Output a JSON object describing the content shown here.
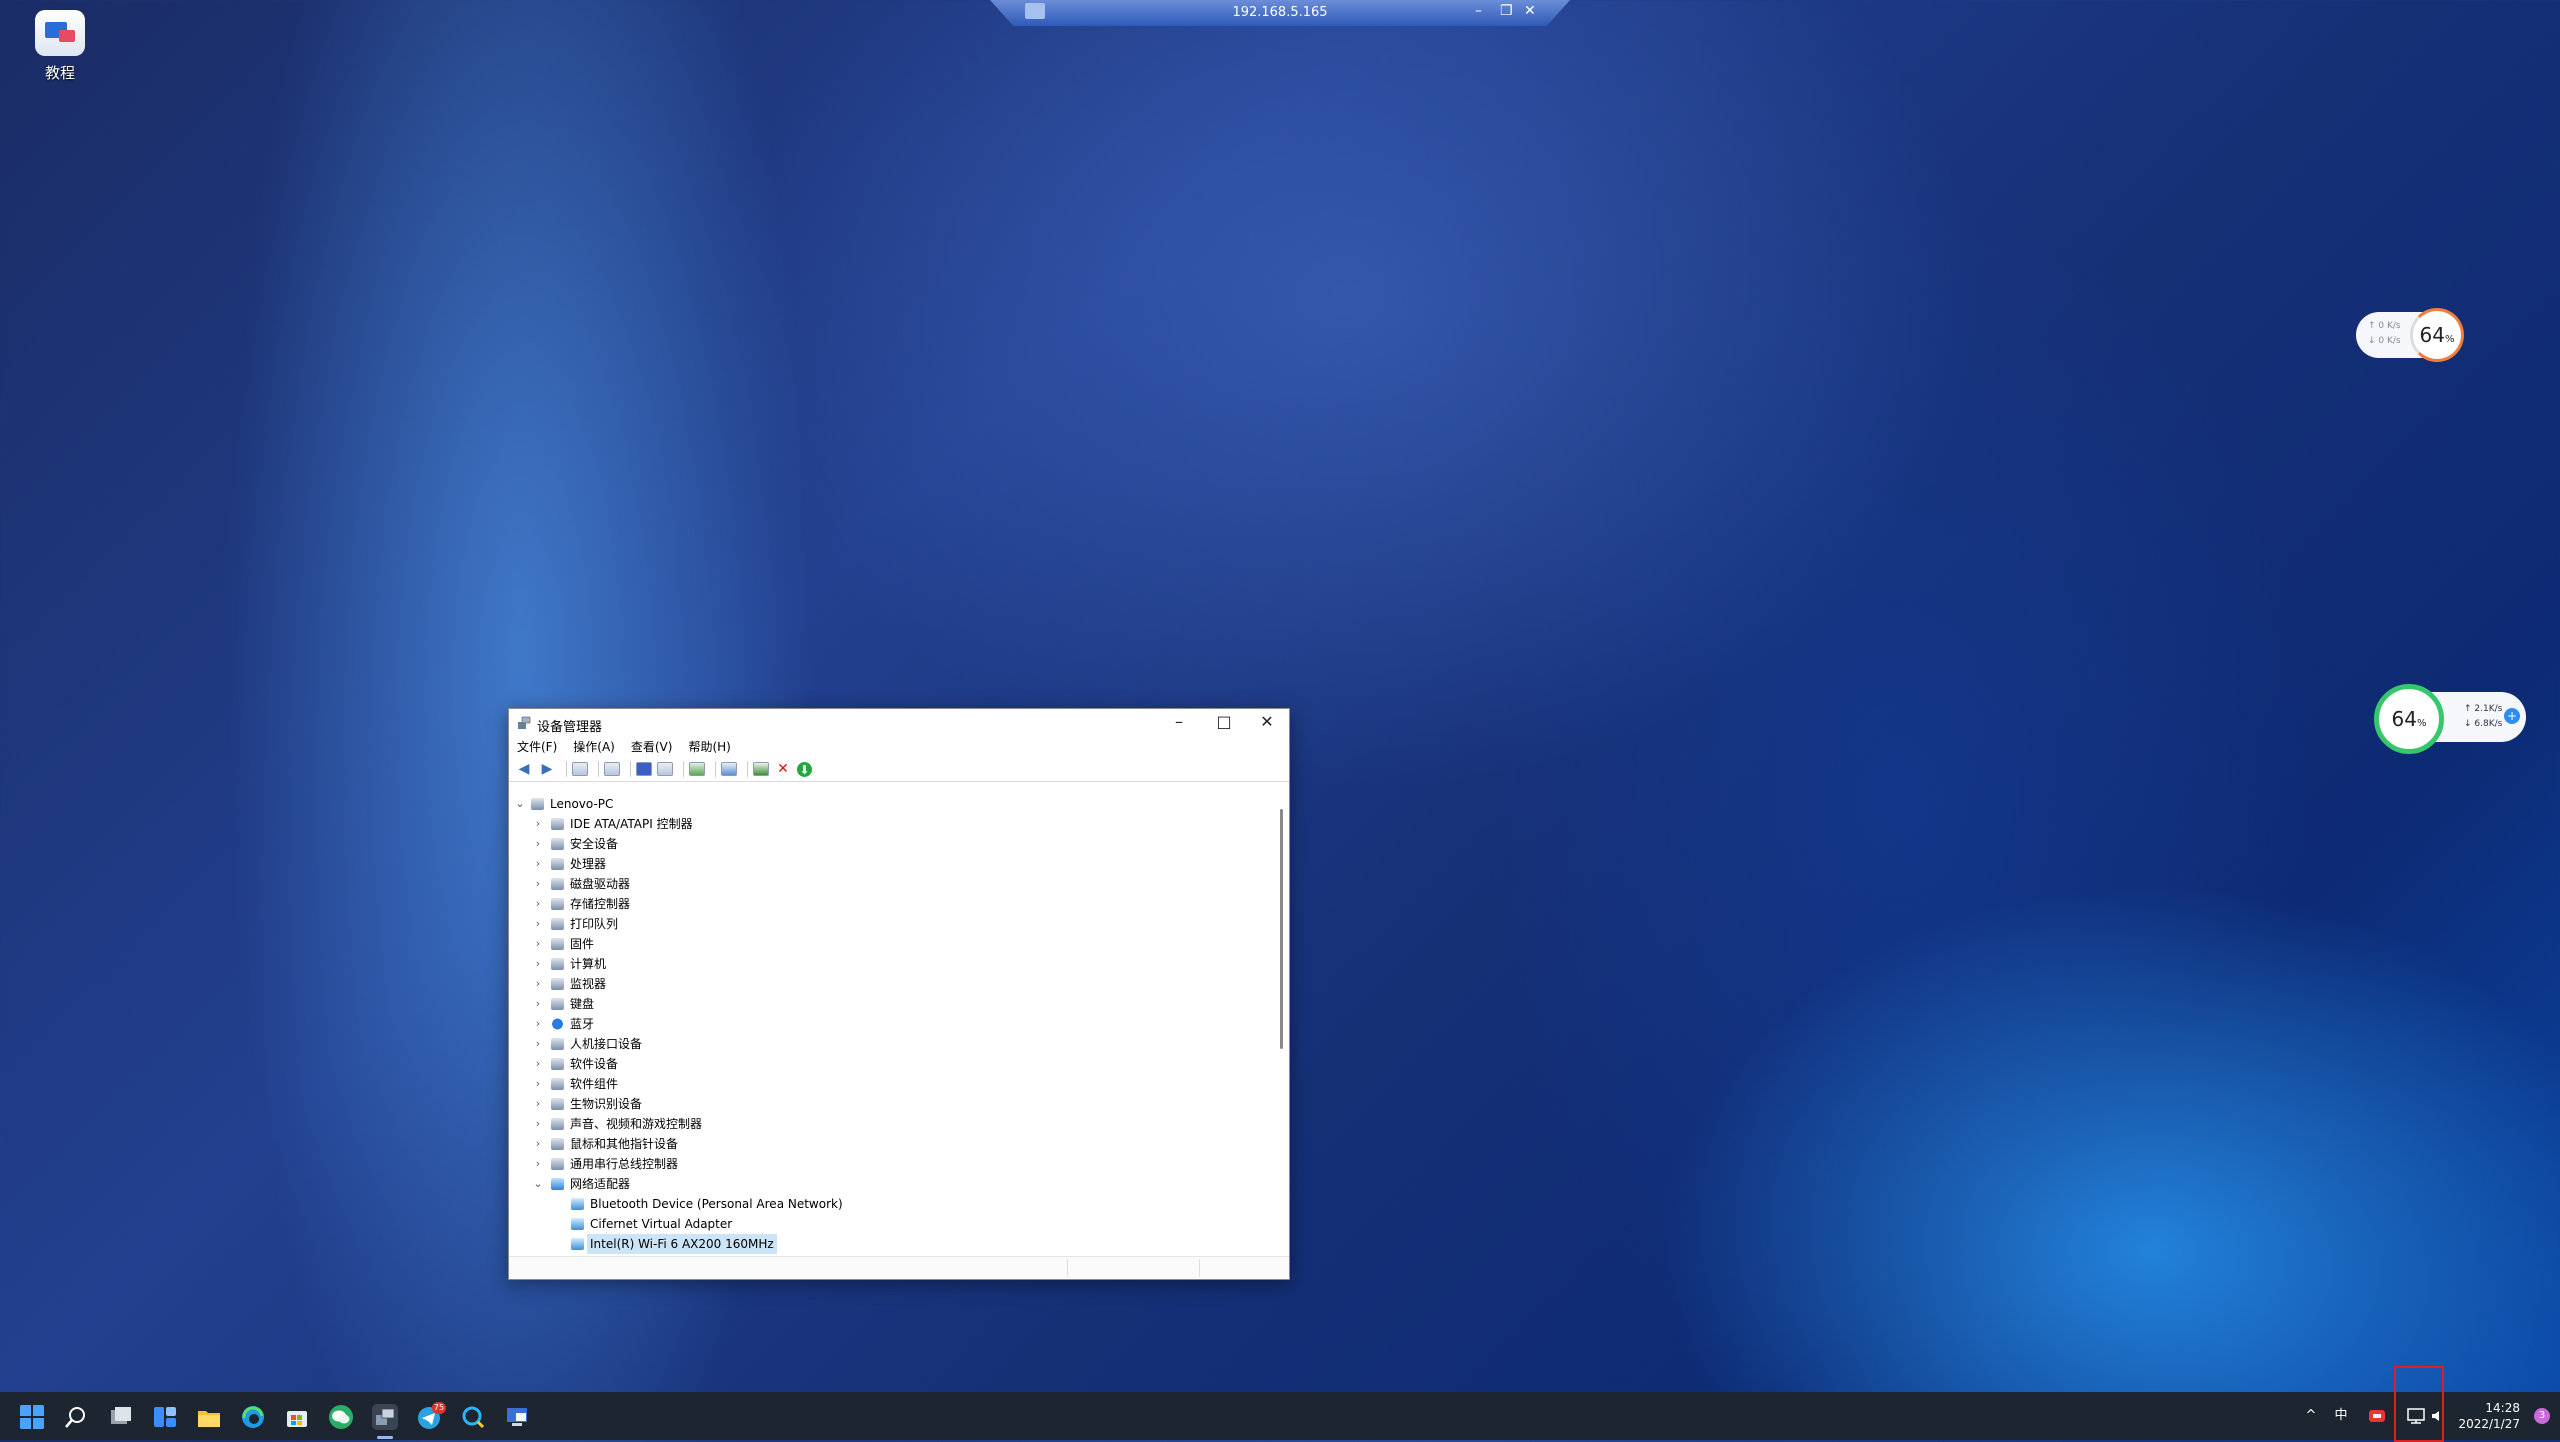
{
  "desktop": {
    "icon_label": "教程"
  },
  "rdp": {
    "ip": "192.168.5.165"
  },
  "widget_top": {
    "percent": "64",
    "unit": "%",
    "up": "↑ 0  K/s",
    "down": "↓ 0  K/s"
  },
  "widget_side": {
    "percent": "64",
    "unit": "%",
    "up": "↑  2.1K/s",
    "down": "↓  6.8K/s",
    "plus": "+"
  },
  "window": {
    "title": "设备管理器",
    "controls": {
      "minimize": "–",
      "maximize": "□",
      "close": "✕"
    },
    "menu": [
      "文件(F)",
      "操作(A)",
      "查看(V)",
      "帮助(H)"
    ],
    "tree": {
      "root": "Lenovo-PC",
      "categories": [
        "IDE ATA/ATAPI 控制器",
        "安全设备",
        "处理器",
        "磁盘驱动器",
        "存储控制器",
        "打印队列",
        "固件",
        "计算机",
        "监视器",
        "键盘",
        "蓝牙",
        "人机接口设备",
        "软件设备",
        "软件组件",
        "生物识别设备",
        "声音、视频和游戏控制器",
        "鼠标和其他指针设备",
        "通用串行总线控制器",
        "网络适配器"
      ],
      "network_children": [
        "Bluetooth Device (Personal Area Network)",
        "Cifernet Virtual Adapter",
        "Intel(R) Wi-Fi 6 AX200 160MHz"
      ]
    }
  },
  "taskbar": {
    "tray_ime": "中",
    "tray_chevron": "^",
    "time": "14:28",
    "date": "2022/1/27",
    "notification_count": "3",
    "app_badge": "75"
  },
  "colors": {
    "taskbar": "#1d2530",
    "selection": "#cce4f7",
    "highlight": "#e02020"
  }
}
